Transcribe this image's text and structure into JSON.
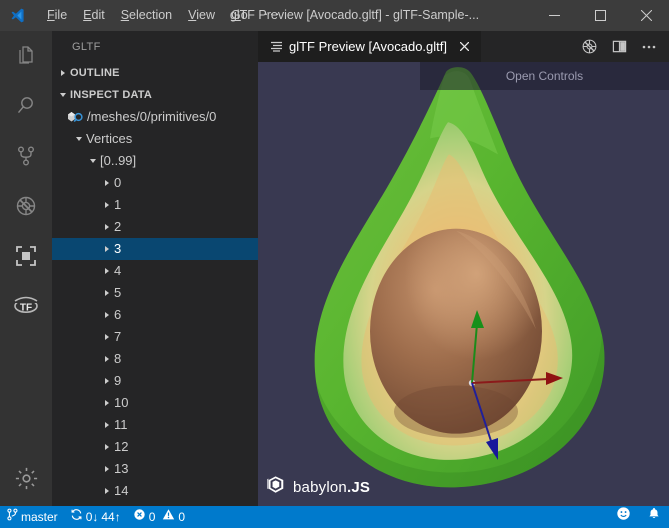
{
  "window": {
    "title": "glTF Preview [Avocado.gltf] - glTF-Sample-...",
    "logo_icon": "vscode-logo-icon",
    "minimize_icon": "minimize-icon",
    "maximize_icon": "maximize-icon",
    "close_icon": "close-icon"
  },
  "menubar": {
    "items": [
      {
        "label": "File",
        "mnemonic": "F",
        "rest": "ile"
      },
      {
        "label": "Edit",
        "mnemonic": "E",
        "rest": "dit"
      },
      {
        "label": "Selection",
        "mnemonic": "S",
        "rest": "election"
      },
      {
        "label": "View",
        "mnemonic": "V",
        "rest": "iew"
      },
      {
        "label": "Go",
        "mnemonic": "G",
        "rest": "o"
      }
    ],
    "more_label": "···"
  },
  "activitybar": {
    "items": [
      {
        "name": "explorer",
        "icon": "files-icon",
        "active": false
      },
      {
        "name": "search",
        "icon": "search-icon",
        "active": false
      },
      {
        "name": "source-control",
        "icon": "source-control-icon",
        "active": false
      },
      {
        "name": "run-and-debug",
        "icon": "debug-alt-icon",
        "active": false
      },
      {
        "name": "gltf-tools",
        "icon": "gltf-cube-icon",
        "active": true
      },
      {
        "name": "tensorflow",
        "icon": "tf-icon",
        "active": false
      }
    ],
    "bottom": [
      {
        "name": "manage-settings",
        "icon": "gear-icon"
      }
    ]
  },
  "sidebar": {
    "title": "GLTF",
    "sections": [
      {
        "label": "OUTLINE",
        "expanded": false
      },
      {
        "label": "INSPECT DATA",
        "expanded": true
      }
    ],
    "mesh_path": "/meshes/0/primitives/0",
    "mesh_icon": "mesh-inspect-icon",
    "tree": [
      {
        "label": "Vertices",
        "depth": 1,
        "twisty": "down",
        "selected": false
      },
      {
        "label": "[0..99]",
        "depth": 2,
        "twisty": "down",
        "selected": false
      },
      {
        "label": "0",
        "depth": 3,
        "twisty": "right",
        "selected": false
      },
      {
        "label": "1",
        "depth": 3,
        "twisty": "right",
        "selected": false
      },
      {
        "label": "2",
        "depth": 3,
        "twisty": "right",
        "selected": false
      },
      {
        "label": "3",
        "depth": 3,
        "twisty": "right",
        "selected": true
      },
      {
        "label": "4",
        "depth": 3,
        "twisty": "right",
        "selected": false
      },
      {
        "label": "5",
        "depth": 3,
        "twisty": "right",
        "selected": false
      },
      {
        "label": "6",
        "depth": 3,
        "twisty": "right",
        "selected": false
      },
      {
        "label": "7",
        "depth": 3,
        "twisty": "right",
        "selected": false
      },
      {
        "label": "8",
        "depth": 3,
        "twisty": "right",
        "selected": false
      },
      {
        "label": "9",
        "depth": 3,
        "twisty": "right",
        "selected": false
      },
      {
        "label": "10",
        "depth": 3,
        "twisty": "right",
        "selected": false
      },
      {
        "label": "11",
        "depth": 3,
        "twisty": "right",
        "selected": false
      },
      {
        "label": "12",
        "depth": 3,
        "twisty": "right",
        "selected": false
      },
      {
        "label": "13",
        "depth": 3,
        "twisty": "right",
        "selected": false
      },
      {
        "label": "14",
        "depth": 3,
        "twisty": "right",
        "selected": false
      }
    ]
  },
  "editor": {
    "tab": {
      "label": "glTF Preview [Avocado.gltf]",
      "icon": "preview-lines-icon",
      "close_icon": "close-icon"
    },
    "actions": [
      {
        "name": "gltf-preview-toggle",
        "icon": "compass-slash-icon"
      },
      {
        "name": "split-editor",
        "icon": "split-editor-icon"
      },
      {
        "name": "more-actions",
        "icon": "ellipsis-icon"
      }
    ]
  },
  "viewport": {
    "open_controls_label": "Open Controls",
    "watermark": {
      "prefix": "babylon",
      "dot": ".",
      "suffix": "JS",
      "icon": "babylon-cube-icon"
    },
    "gizmo": {
      "axes": [
        {
          "name": "x-axis",
          "color": "#8b1a1a"
        },
        {
          "name": "y-axis",
          "color": "#1a8b1a"
        },
        {
          "name": "z-axis",
          "color": "#1a1a9b"
        }
      ]
    },
    "background_color": "#393951"
  },
  "statusbar": {
    "branch": {
      "icon": "source-control-icon",
      "label": "master"
    },
    "sync": {
      "icon": "sync-icon",
      "down": "0↓",
      "up": "44↑"
    },
    "problems": {
      "error_icon": "error-icon",
      "errors": "0",
      "warning_icon": "warning-icon",
      "warnings": "0"
    },
    "right": [
      {
        "name": "feedback",
        "icon": "smiley-icon"
      },
      {
        "name": "notifications",
        "icon": "bell-icon"
      }
    ],
    "background_color": "#007acc"
  }
}
